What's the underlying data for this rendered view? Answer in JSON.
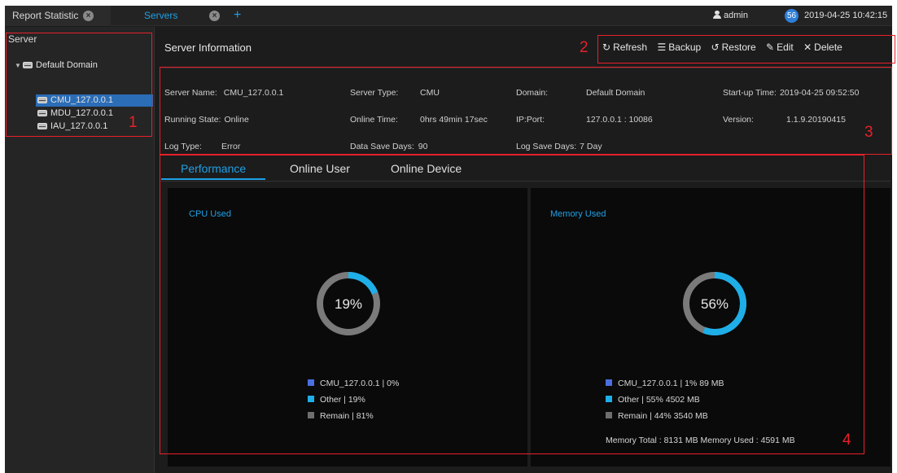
{
  "topbar": {
    "tabs": [
      {
        "label": "Report Statistic"
      },
      {
        "label": "Servers"
      }
    ],
    "add_icon": "+",
    "user": "admin",
    "badge": "56",
    "datetime": "2019-04-25 10:42:15"
  },
  "sidebar": {
    "title": "Server",
    "domain": "Default Domain",
    "servers": [
      "CMU_127.0.0.1",
      "MDU_127.0.0.1",
      "IAU_127.0.0.1"
    ],
    "selected": "CMU_127.0.0.1"
  },
  "main": {
    "title": "Server Information",
    "toolbar": {
      "refresh": "Refresh",
      "backup": "Backup",
      "restore": "Restore",
      "edit": "Edit",
      "delete": "Delete"
    },
    "info": {
      "server_name_label": "Server Name:",
      "server_name": "CMU_127.0.0.1",
      "server_type_label": "Server Type:",
      "server_type": "CMU",
      "domain_label": "Domain:",
      "domain": "Default Domain",
      "startup_label": "Start-up Time:",
      "startup": "2019-04-25 09:52:50",
      "running_label": "Running State:",
      "running": "Online",
      "online_time_label": "Online Time:",
      "online_time": "0hrs 49min 17sec",
      "ipport_label": "IP:Port:",
      "ipport": "127.0.0.1 : 10086",
      "version_label": "Version:",
      "version": "1.1.9.20190415",
      "logtype_label": "Log Type:",
      "logtype": "Error",
      "datasave_label": "Data Save Days:",
      "datasave": "90",
      "logsave_label": "Log Save Days:",
      "logsave": "7 Day"
    },
    "tabs": [
      "Performance",
      "Online User",
      "Online Device"
    ],
    "cpu": {
      "title": "CPU Used",
      "center": "19%",
      "used_fraction": 0.19,
      "legend": [
        {
          "text": "CMU_127.0.0.1 | 0%",
          "color": "#4a6fe0"
        },
        {
          "text": "Other | 19%",
          "color": "#1eaee8"
        },
        {
          "text": "Remain | 81%",
          "color": "#6e6e6e"
        }
      ]
    },
    "memory": {
      "title": "Memory Used",
      "center": "56%",
      "used_fraction": 0.56,
      "legend": [
        {
          "text": "CMU_127.0.0.1 | 1% 89 MB",
          "color": "#4a6fe0"
        },
        {
          "text": "Other | 55% 4502 MB",
          "color": "#1eaee8"
        },
        {
          "text": "Remain | 44% 3540 MB",
          "color": "#6e6e6e"
        }
      ],
      "totals": "Memory Total : 8131 MB  Memory Used : 4591 MB"
    }
  },
  "callouts": [
    "1",
    "2",
    "3",
    "4"
  ],
  "colors": {
    "accent": "#1ea0e6",
    "callout": "#e8202a",
    "ring_bg": "#7a7a7a",
    "ring_fg": "#1eaee8"
  }
}
